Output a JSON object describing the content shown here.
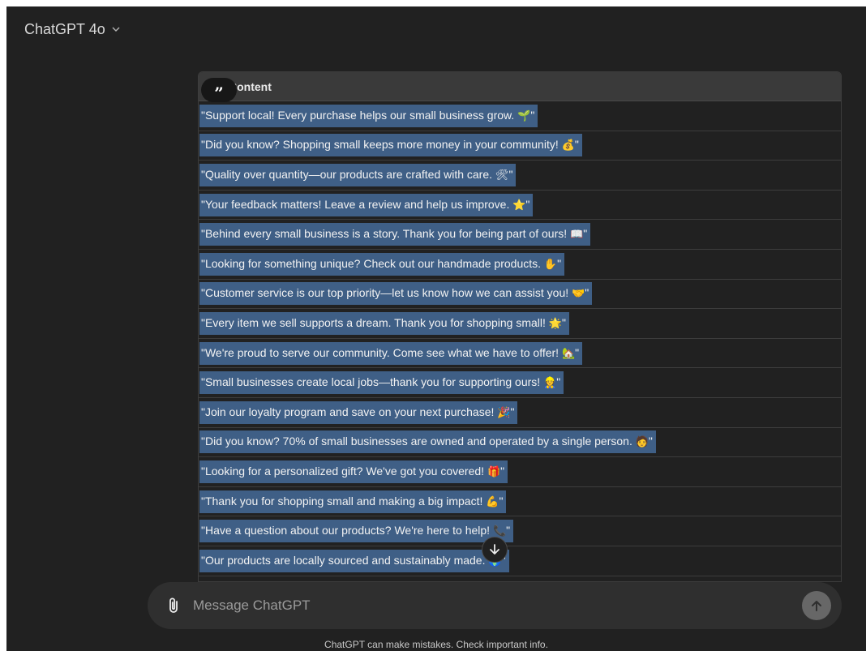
{
  "header": {
    "model_label": "ChatGPT 4o"
  },
  "table": {
    "column_header": "Content",
    "rows": [
      {
        "text": "\"Support local! Every purchase helps our small business grow. ",
        "emoji": "🌱",
        "end": "\""
      },
      {
        "text": "\"Did you know? Shopping small keeps more money in your community! ",
        "emoji": "💰",
        "end": "\""
      },
      {
        "text": "\"Quality over quantity—our products are crafted with care. ",
        "emoji": "🛠",
        "end": "\""
      },
      {
        "text": "\"Your feedback matters! Leave a review and help us improve. ",
        "emoji": "⭐",
        "end": "\""
      },
      {
        "text": "\"Behind every small business is a story. Thank you for being part of ours! ",
        "emoji": "📖",
        "end": "\""
      },
      {
        "text": "\"Looking for something unique? Check out our handmade products. ",
        "emoji": "✋",
        "end": "\""
      },
      {
        "text": "\"Customer service is our top priority—let us know how we can assist you! ",
        "emoji": "🤝",
        "end": "\""
      },
      {
        "text": "\"Every item we sell supports a dream. Thank you for shopping small! ",
        "emoji": "🌟",
        "end": "\""
      },
      {
        "text": "\"We're proud to serve our community. Come see what we have to offer! ",
        "emoji": "🏡",
        "end": "\""
      },
      {
        "text": "\"Small businesses create local jobs—thank you for supporting ours! ",
        "emoji": "👷",
        "end": "\""
      },
      {
        "text": "\"Join our loyalty program and save on your next purchase! ",
        "emoji": "🎉",
        "end": "\""
      },
      {
        "text": "\"Did you know? 70% of small businesses are owned and operated by a single person. ",
        "emoji": "🧑",
        "end": "\""
      },
      {
        "text": "\"Looking for a personalized gift? We've got you covered! ",
        "emoji": "🎁",
        "end": "\""
      },
      {
        "text": "\"Thank you for shopping small and making a big impact! ",
        "emoji": "💪",
        "end": "\""
      },
      {
        "text": "\"Have a question about our products? We're here to help! ",
        "emoji": "📞",
        "end": "\""
      },
      {
        "text": "\"Our products are locally sourced and sustainably made. ",
        "emoji": "🌍",
        "end": "\""
      }
    ]
  },
  "composer": {
    "placeholder": "Message ChatGPT"
  },
  "footer": {
    "disclaimer": "ChatGPT can make mistakes. Check important info."
  },
  "colors": {
    "background": "#212121",
    "selection": "#3f5f86",
    "table_header": "#3a3a3a",
    "composer": "#2f2f2f",
    "send_button": "#676767"
  },
  "icons": [
    "chevron-down-icon",
    "quote-icon",
    "arrow-down-icon",
    "paperclip-icon",
    "arrow-up-icon"
  ]
}
